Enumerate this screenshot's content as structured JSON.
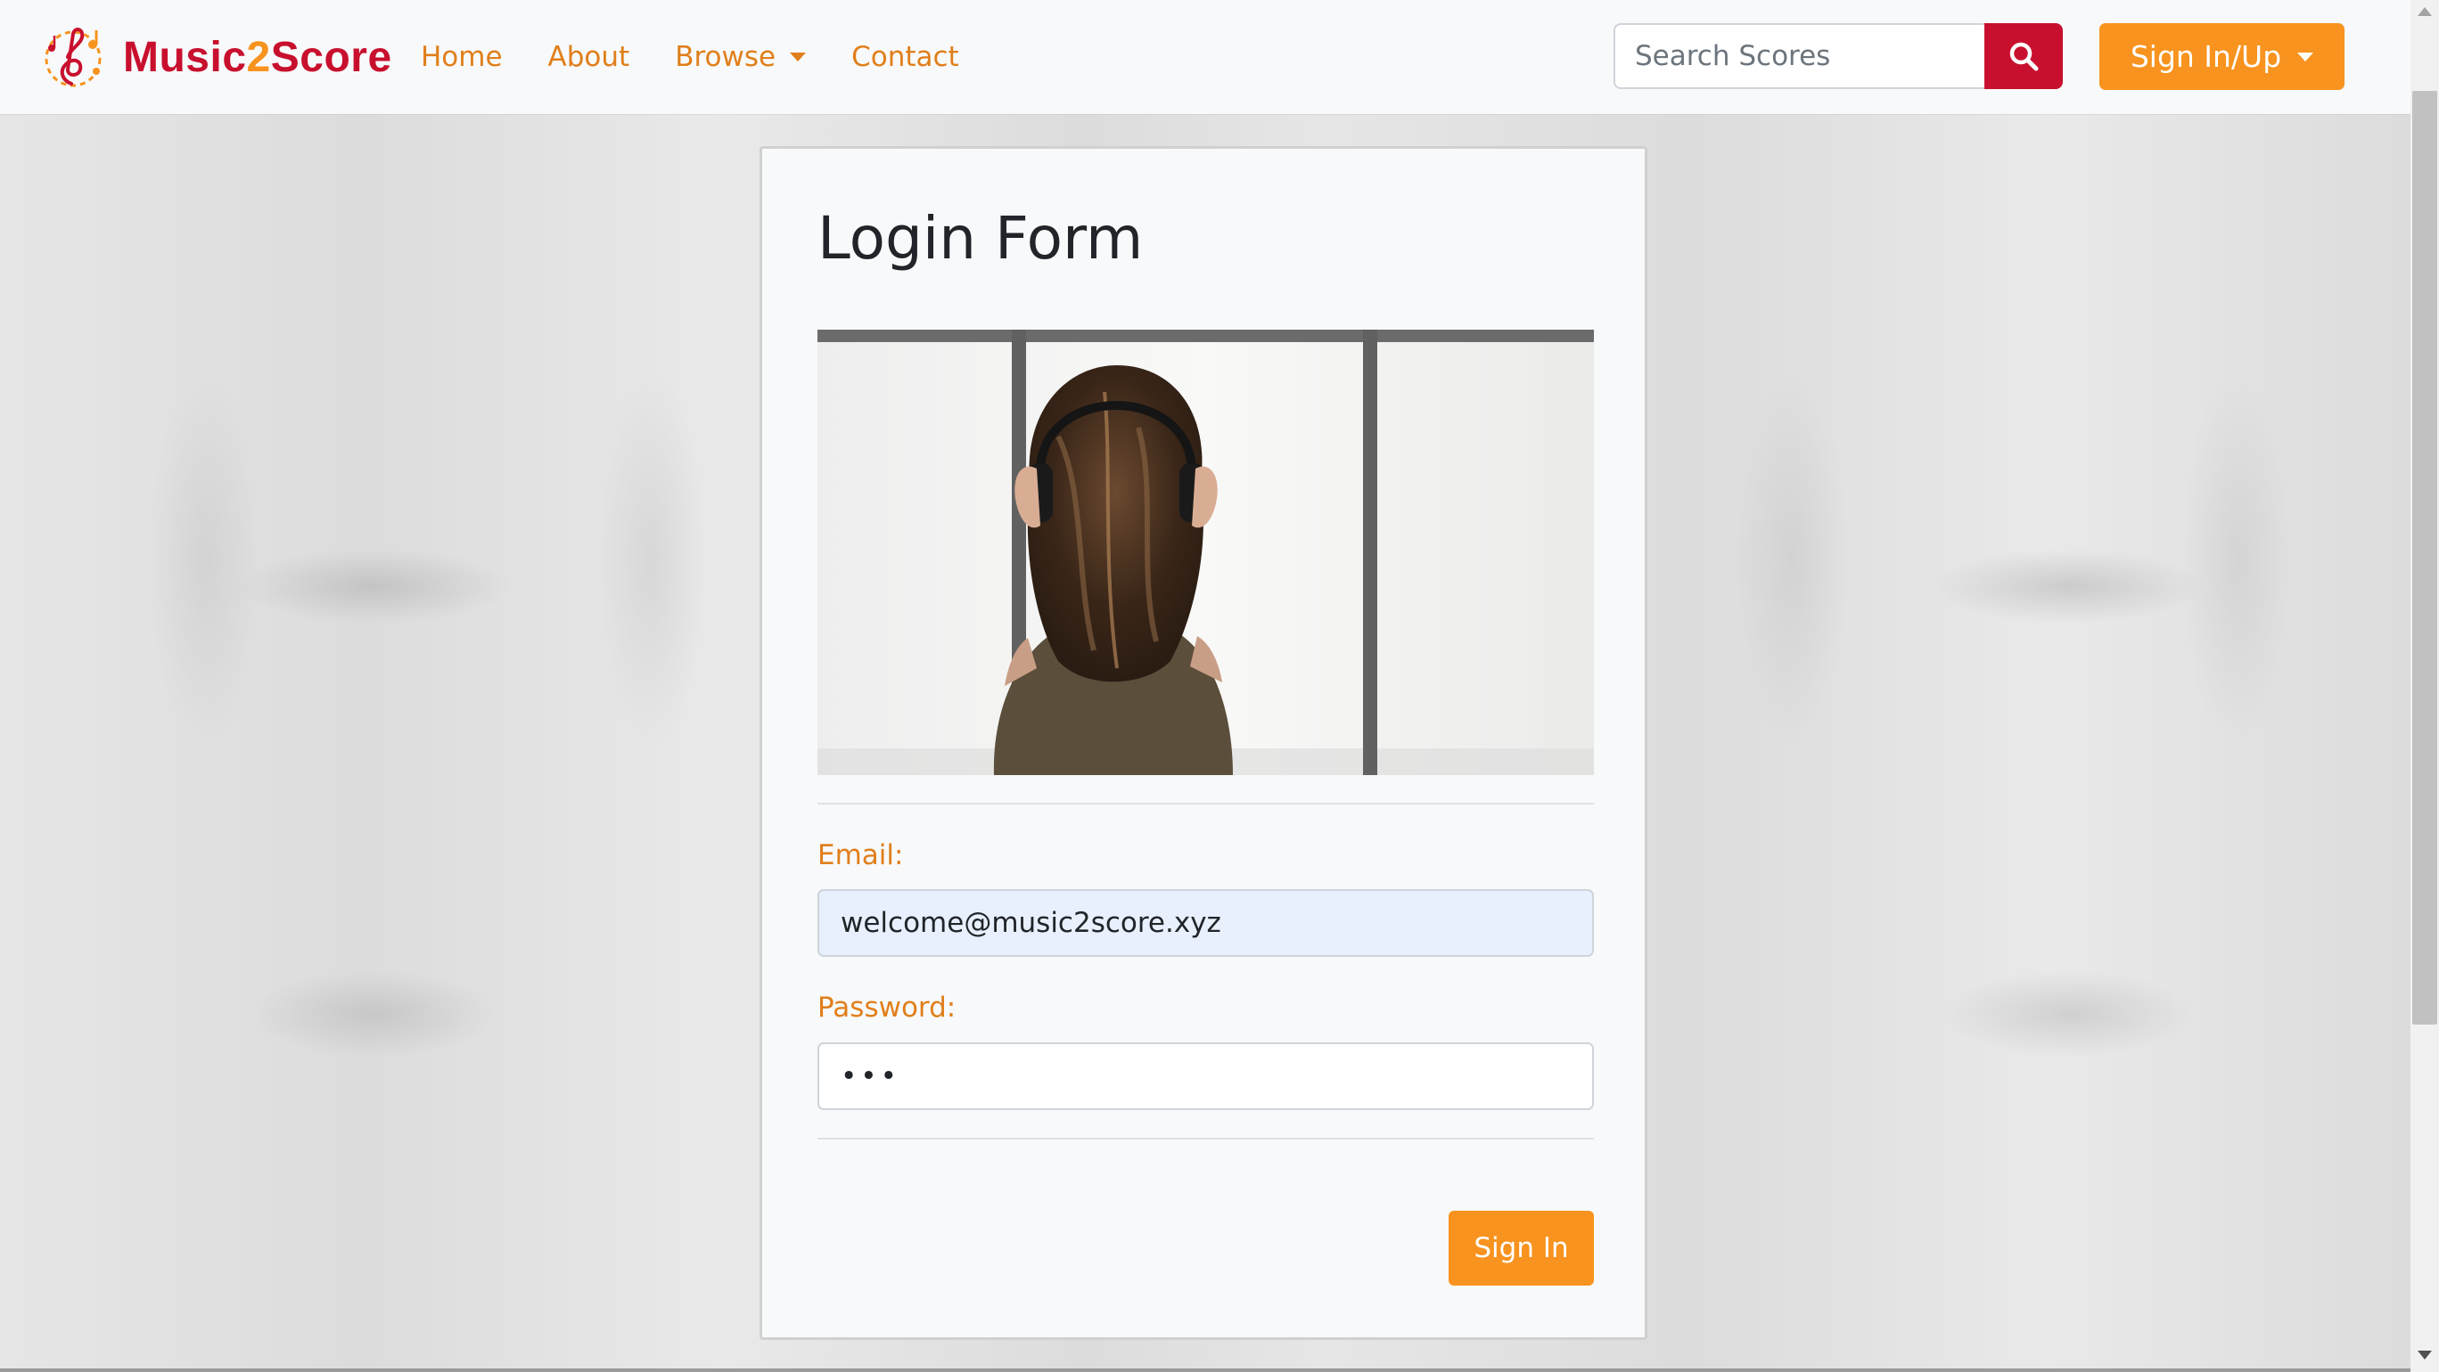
{
  "brand": {
    "name_part1": "Music",
    "name_part2": "2",
    "name_part3": "Score",
    "logo_icon": "music-note-logo-icon"
  },
  "nav": {
    "links": [
      {
        "label": "Home"
      },
      {
        "label": "About"
      },
      {
        "label": "Browse",
        "has_dropdown": true
      },
      {
        "label": "Contact"
      }
    ]
  },
  "search": {
    "placeholder": "Search Scores",
    "value": "",
    "button_icon": "search-icon"
  },
  "account": {
    "label": "Sign In/Up",
    "has_dropdown": true
  },
  "login": {
    "title": "Login Form",
    "image_alt": "woman-with-headphones-photo",
    "email_label": "Email:",
    "email_value": "welcome@music2score.xyz",
    "password_label": "Password:",
    "password_value": "•••",
    "submit_label": "Sign In"
  },
  "colors": {
    "brand_red": "#c8102e",
    "accent_orange": "#f7931e",
    "link_orange": "#e07f1b",
    "autofill_blue": "#e8f0fe"
  }
}
